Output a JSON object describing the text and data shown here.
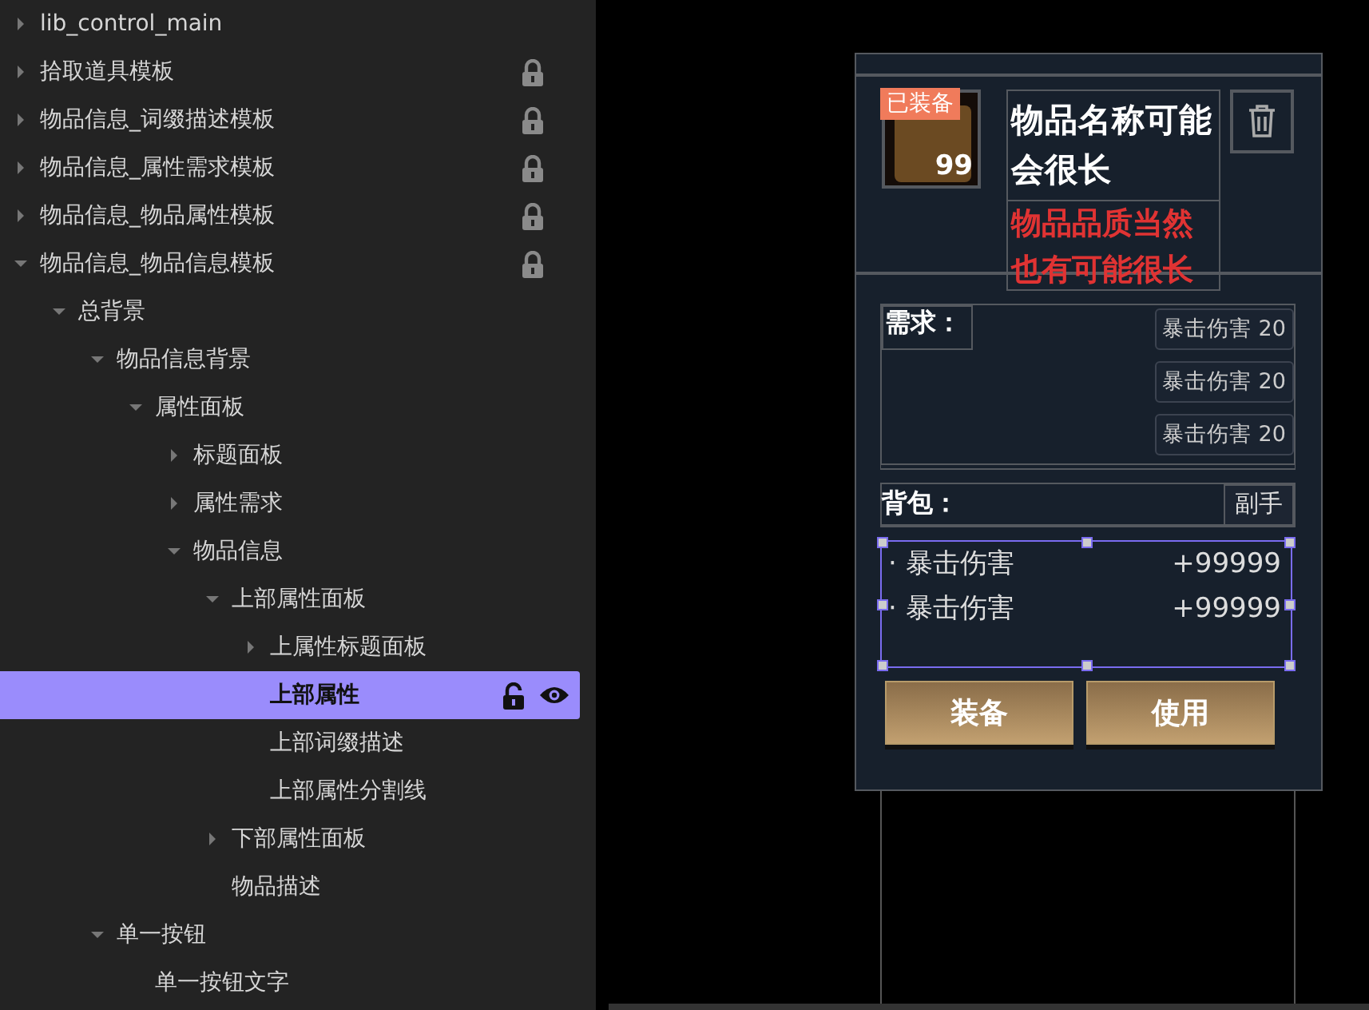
{
  "tree": [
    {
      "label": "lib_control_main",
      "expanded": false,
      "selected": false
    },
    {
      "label": "拾取道具模板",
      "expanded": false,
      "selected": false,
      "locked": true
    },
    {
      "label": "物品信息_词缀描述模板",
      "expanded": false,
      "selected": false,
      "locked": true
    },
    {
      "label": "物品信息_属性需求模板",
      "expanded": false,
      "selected": false,
      "locked": true
    },
    {
      "label": "物品信息_物品属性模板",
      "expanded": false,
      "selected": false,
      "locked": true
    },
    {
      "label": "物品信息_物品信息模板",
      "expanded": true,
      "selected": false,
      "locked": true,
      "children": [
        {
          "label": "总背景",
          "expanded": true,
          "selected": false,
          "children": [
            {
              "label": "物品信息背景",
              "expanded": true,
              "selected": false,
              "children": [
                {
                  "label": "属性面板",
                  "expanded": true,
                  "selected": false,
                  "children": [
                    {
                      "label": "标题面板",
                      "expanded": false,
                      "selected": false
                    },
                    {
                      "label": "属性需求",
                      "expanded": false,
                      "selected": false
                    },
                    {
                      "label": "物品信息",
                      "expanded": true,
                      "selected": false,
                      "children": [
                        {
                          "label": "上部属性面板",
                          "expanded": true,
                          "selected": false,
                          "children": [
                            {
                              "label": "上属性标题面板",
                              "expanded": false,
                              "selected": false
                            },
                            {
                              "label": "上部属性",
                              "selected": true,
                              "locked": false,
                              "visible": true
                            },
                            {
                              "label": "上部词缀描述",
                              "selected": false
                            },
                            {
                              "label": "上部属性分割线",
                              "selected": false
                            }
                          ]
                        },
                        {
                          "label": "下部属性面板",
                          "expanded": false,
                          "selected": false
                        },
                        {
                          "label": "物品描述",
                          "selected": false
                        }
                      ]
                    }
                  ]
                }
              ]
            },
            {
              "label": "单一按钮",
              "expanded": true,
              "selected": false,
              "children": [
                {
                  "label": "单一按钮文字",
                  "selected": false
                }
              ]
            }
          ]
        }
      ]
    }
  ],
  "preview": {
    "badge": "已装备",
    "count": "99",
    "item_name": "物品名称可能会很长",
    "quality": "物品品质当然也有可能很长",
    "requirements": {
      "label": "需求：",
      "chips": [
        "暴击伤害 20",
        "暴击伤害 20",
        "暴击伤害 20"
      ]
    },
    "bag": {
      "label": "背包：",
      "slot": "副手"
    },
    "attributes": [
      {
        "bullet": "·",
        "name": "暴击伤害",
        "value": "+99999"
      },
      {
        "bullet": "·",
        "name": "暴击伤害",
        "value": "+99999"
      }
    ],
    "buttons": [
      "装备",
      "使用"
    ]
  }
}
